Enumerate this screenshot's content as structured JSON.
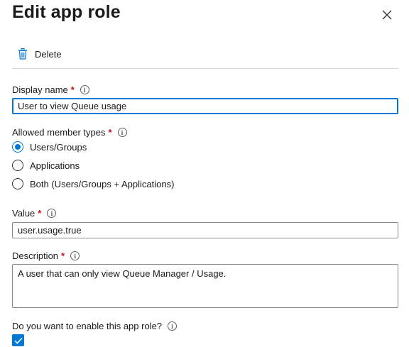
{
  "panel": {
    "title": "Edit app role",
    "close_icon": "close-icon"
  },
  "toolbar": {
    "delete_label": "Delete",
    "delete_icon": "trash-icon"
  },
  "display_name": {
    "label": "Display name",
    "required_marker": "*",
    "value": "User to view Queue usage"
  },
  "member_types": {
    "label": "Allowed member types",
    "required_marker": "*",
    "options": [
      {
        "label": "Users/Groups",
        "checked": true
      },
      {
        "label": "Applications",
        "checked": false
      },
      {
        "label": "Both (Users/Groups + Applications)",
        "checked": false
      }
    ]
  },
  "value_field": {
    "label": "Value",
    "required_marker": "*",
    "value": "user.usage.true"
  },
  "description": {
    "label": "Description",
    "required_marker": "*",
    "value": "A user that can only view Queue Manager / Usage."
  },
  "enable": {
    "label": "Do you want to enable this app role?",
    "checked": true
  },
  "info_glyph": "i",
  "colors": {
    "accent": "#0078d4",
    "required": "#c50f1f",
    "border": "#8a8886",
    "divider": "#d6d6d6"
  }
}
